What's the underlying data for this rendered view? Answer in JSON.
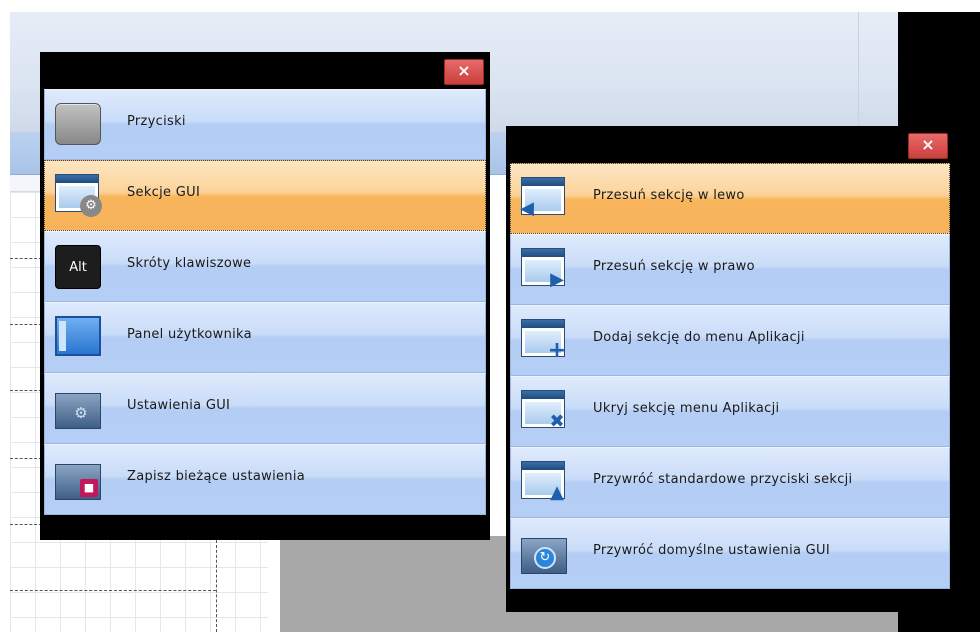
{
  "background": {
    "ruler_tick": "17"
  },
  "panel_left": {
    "close_label": "×",
    "items": [
      {
        "label": "Przyciski",
        "icon": "button-icon"
      },
      {
        "label": "Sekcje GUI",
        "icon": "gui-section-icon",
        "active": true
      },
      {
        "label": "Skróty klawiszowe",
        "icon": "alt-key-icon",
        "key_text": "Alt"
      },
      {
        "label": "Panel użytkownika",
        "icon": "user-panel-icon"
      },
      {
        "label": "Ustawienia GUI",
        "icon": "gui-settings-icon"
      },
      {
        "label": "Zapisz bieżące ustawienia",
        "icon": "save-settings-icon"
      }
    ]
  },
  "panel_right": {
    "close_label": "×",
    "items": [
      {
        "label": "Przesuń sekcję w  lewo",
        "icon": "move-section-left-icon",
        "active": true
      },
      {
        "label": "Przesuń sekcję w  prawo",
        "icon": "move-section-right-icon"
      },
      {
        "label": "Dodaj sekcję do menu Aplikacji",
        "icon": "add-section-icon"
      },
      {
        "label": "Ukryj sekcję menu Aplikacji",
        "icon": "hide-section-icon"
      },
      {
        "label": "Przywróć standardowe przyciski sekcji",
        "icon": "restore-buttons-icon"
      },
      {
        "label": "Przywróć domyślne ustawienia GUI",
        "icon": "restore-gui-icon"
      }
    ]
  },
  "colors": {
    "active_item": "#f8b55c",
    "item": "#c9dcf8",
    "close": "#d14c49"
  }
}
